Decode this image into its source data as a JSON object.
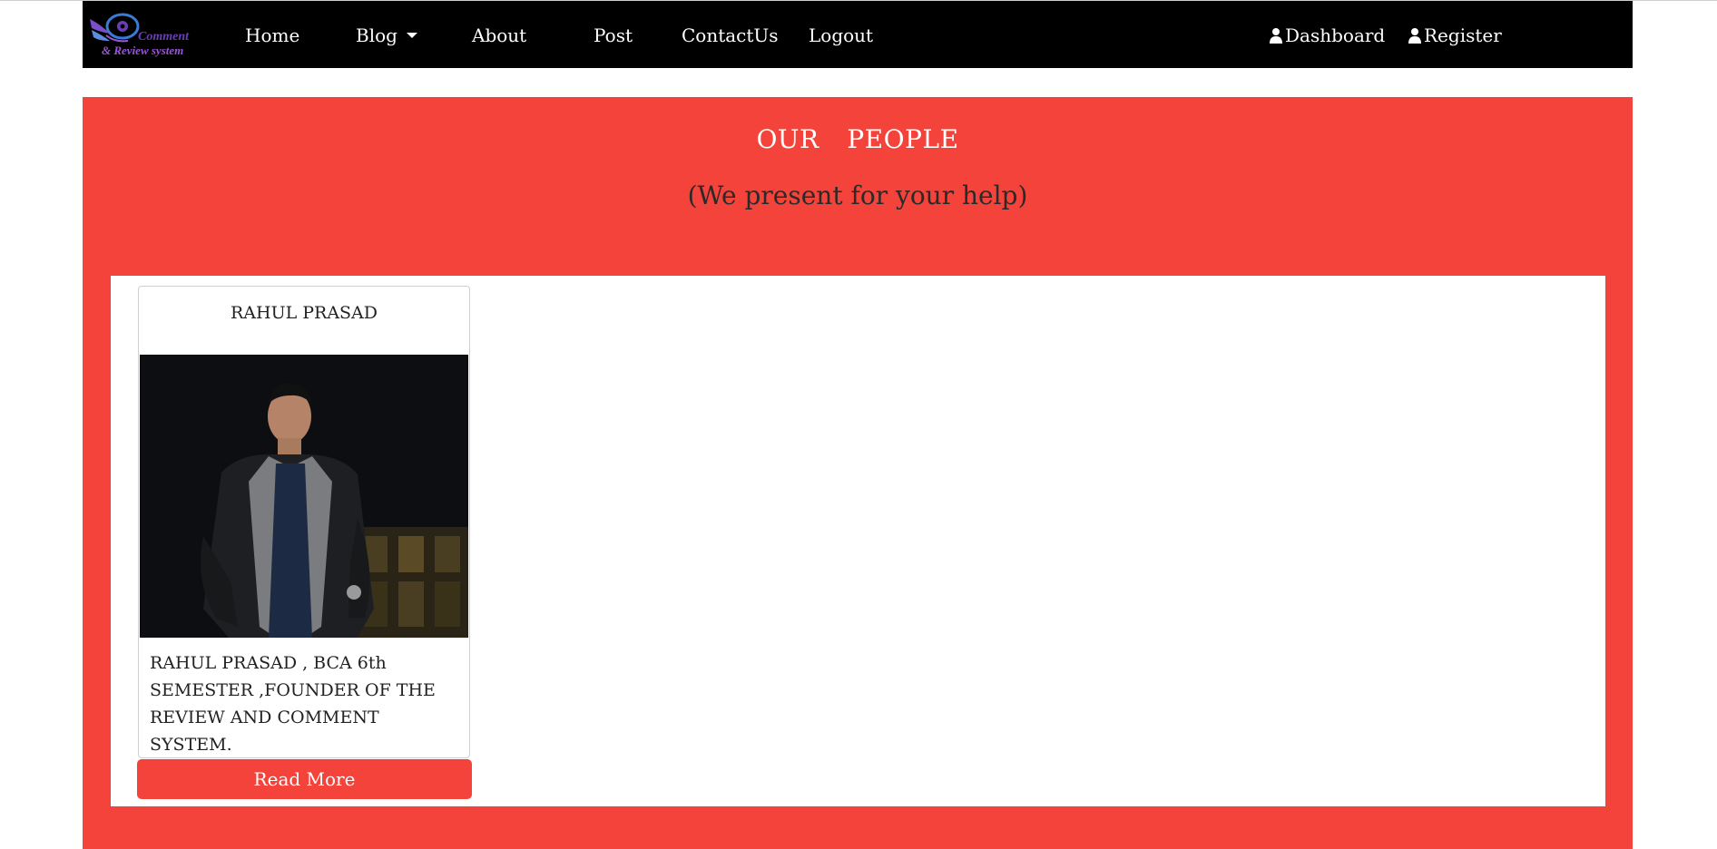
{
  "navbar": {
    "logo": {
      "line1": "Comment",
      "line2": "& Review system",
      "icon": "eye-wing-logo"
    },
    "items": [
      {
        "label": "Home"
      },
      {
        "label": "Blog",
        "has_dropdown": true
      },
      {
        "label": "About"
      },
      {
        "label": "Post"
      },
      {
        "label": "ContactUs"
      },
      {
        "label": "Logout"
      }
    ],
    "right_items": [
      {
        "label": "Dashboard",
        "icon": "user-icon"
      },
      {
        "label": "Register",
        "icon": "user-icon"
      }
    ]
  },
  "hero": {
    "title": "OUR  PEOPLE",
    "subtitle": "(We present for your help)"
  },
  "people": [
    {
      "name": "RAHUL PRASAD",
      "description": "RAHUL PRASAD , BCA 6th SEMESTER ,FOUNDER OF THE REVIEW AND COMMENT SYSTEM.",
      "button_label": "Read More"
    }
  ],
  "colors": {
    "accent": "#f4433a",
    "navbar_bg": "#000000",
    "logo_purple": "#6a3fb4"
  }
}
